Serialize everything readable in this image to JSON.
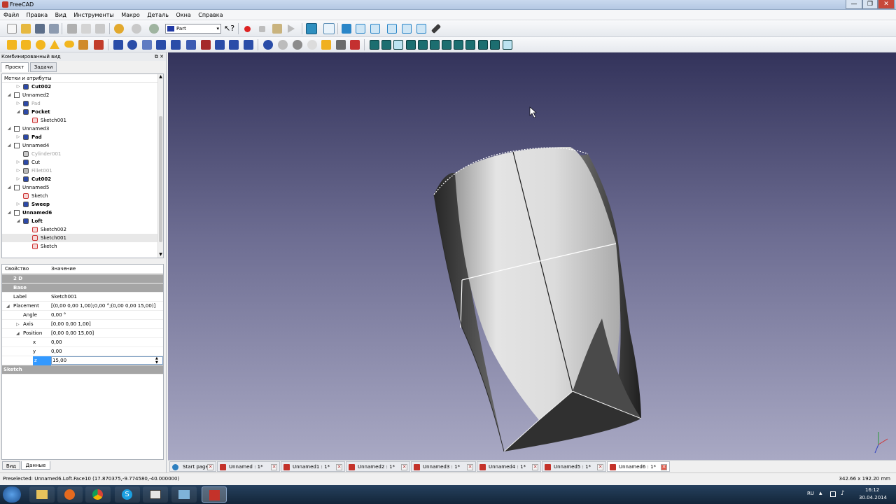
{
  "window": {
    "title": "FreeCAD"
  },
  "menu": [
    "Файл",
    "Правка",
    "Вид",
    "Инструменты",
    "Макро",
    "Деталь",
    "Окна",
    "Справка"
  ],
  "workbench": {
    "selected": "Part"
  },
  "combo": {
    "title": "Комбинированный вид",
    "tabs": [
      "Проект",
      "Задачи"
    ],
    "tree_header": "Метки и атрибуты",
    "tree": [
      {
        "label": "Cut002",
        "depth": 1,
        "style": "bold",
        "icon": "cut-icon",
        "arrow": "▷"
      },
      {
        "label": "Unnamed2",
        "depth": 0,
        "style": "normal",
        "icon": "document-icon",
        "arrow": "◢"
      },
      {
        "label": "Pad",
        "depth": 1,
        "style": "grey",
        "icon": "pad-icon",
        "arrow": "▷"
      },
      {
        "label": "Pocket",
        "depth": 1,
        "style": "bold",
        "icon": "pocket-icon",
        "arrow": "◢"
      },
      {
        "label": "Sketch001",
        "depth": 2,
        "style": "normal",
        "icon": "sketch-icon",
        "arrow": ""
      },
      {
        "label": "Unnamed3",
        "depth": 0,
        "style": "normal",
        "icon": "document-icon",
        "arrow": "◢"
      },
      {
        "label": "Pad",
        "depth": 1,
        "style": "bold",
        "icon": "pad-icon",
        "arrow": "▷"
      },
      {
        "label": "Unnamed4",
        "depth": 0,
        "style": "normal",
        "icon": "document-icon",
        "arrow": "◢"
      },
      {
        "label": "Cylinder001",
        "depth": 1,
        "style": "grey",
        "icon": "cylinder-icon",
        "arrow": ""
      },
      {
        "label": "Cut",
        "depth": 1,
        "style": "normal",
        "icon": "cut-icon",
        "arrow": "▷"
      },
      {
        "label": "Fillet001",
        "depth": 1,
        "style": "grey",
        "icon": "fillet-icon",
        "arrow": "▷"
      },
      {
        "label": "Cut002",
        "depth": 1,
        "style": "bold",
        "icon": "cut-icon",
        "arrow": "▷"
      },
      {
        "label": "Unnamed5",
        "depth": 0,
        "style": "normal",
        "icon": "document-icon",
        "arrow": "◢"
      },
      {
        "label": "Sketch",
        "depth": 1,
        "style": "normal",
        "icon": "sketch-icon",
        "arrow": ""
      },
      {
        "label": "Sweep",
        "depth": 1,
        "style": "bold",
        "icon": "sweep-icon",
        "arrow": "▷"
      },
      {
        "label": "Unnamed6",
        "depth": 0,
        "style": "bold",
        "icon": "document-icon",
        "arrow": "◢"
      },
      {
        "label": "Loft",
        "depth": 1,
        "style": "bold",
        "icon": "loft-icon",
        "arrow": "◢"
      },
      {
        "label": "Sketch002",
        "depth": 2,
        "style": "normal",
        "icon": "sketch-icon",
        "arrow": ""
      },
      {
        "label": "Sketch001",
        "depth": 2,
        "style": "selected",
        "icon": "sketch-icon",
        "arrow": ""
      },
      {
        "label": "Sketch",
        "depth": 2,
        "style": "normal",
        "icon": "sketch-icon",
        "arrow": ""
      }
    ]
  },
  "properties": {
    "col_property": "Свойство",
    "col_value": "Значение",
    "rows": [
      {
        "type": "group",
        "key": "2 D",
        "value": "",
        "indent": 1,
        "arrow": ""
      },
      {
        "type": "group",
        "key": "Base",
        "value": "",
        "indent": 1,
        "arrow": ""
      },
      {
        "type": "row",
        "key": "Label",
        "value": "Sketch001",
        "indent": 1,
        "arrow": ""
      },
      {
        "type": "row",
        "key": "Placement",
        "value": "[(0,00 0,00 1,00);0,00 °;(0,00 0,00 15,00)]",
        "indent": 1,
        "arrow": "◢"
      },
      {
        "type": "row",
        "key": "Angle",
        "value": "0,00 °",
        "indent": 2,
        "arrow": ""
      },
      {
        "type": "row",
        "key": "Axis",
        "value": "[0,00 0,00 1,00]",
        "indent": 2,
        "arrow": "▷"
      },
      {
        "type": "row",
        "key": "Position",
        "value": "[0,00 0,00 15,00]",
        "indent": 2,
        "arrow": "◢"
      },
      {
        "type": "row",
        "key": "x",
        "value": "0,00",
        "indent": 3,
        "arrow": ""
      },
      {
        "type": "row",
        "key": "y",
        "value": "0,00",
        "indent": 3,
        "arrow": ""
      },
      {
        "type": "edit",
        "key": "z",
        "value": "15,00",
        "indent": 3,
        "arrow": ""
      },
      {
        "type": "group",
        "key": "Sketch",
        "value": "",
        "indent": 0,
        "arrow": ""
      }
    ]
  },
  "bottom_tabs": [
    "Вид",
    "Данные"
  ],
  "doc_tabs": [
    {
      "label": "Start page",
      "icon": "start-page-icon"
    },
    {
      "label": "Unnamed : 1*",
      "icon": "document-icon"
    },
    {
      "label": "Unnamed1 : 1*",
      "icon": "document-icon"
    },
    {
      "label": "Unnamed2 : 1*",
      "icon": "document-icon"
    },
    {
      "label": "Unnamed3 : 1*",
      "icon": "document-icon"
    },
    {
      "label": "Unnamed4 : 1*",
      "icon": "document-icon"
    },
    {
      "label": "Unnamed5 : 1*",
      "icon": "document-icon"
    },
    {
      "label": "Unnamed6 : 1*",
      "icon": "document-icon",
      "active": true
    }
  ],
  "status": {
    "left": "Preselected: Unnamed6.Loft.Face10 (17.870375,-9.774580,-40.000000)",
    "right": "342.66 x 192.20 mm"
  },
  "taskbar": {
    "lang": "RU",
    "time": "16:12",
    "date": "30.04.2014"
  },
  "colors": {
    "accent": "#3399ff",
    "viewport_top": "#33335b",
    "viewport_bottom": "#a9a9c4",
    "group_row": "#a5a5a5"
  }
}
